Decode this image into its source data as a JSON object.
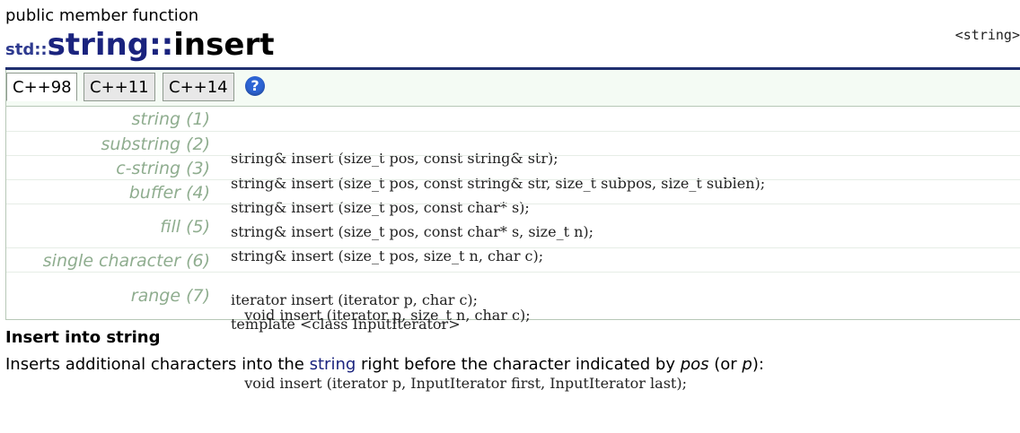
{
  "header": {
    "kind": "public member function",
    "namespace": "std::",
    "class_name": "string",
    "separator": "::",
    "function_name": "insert",
    "header_ref": "<string>"
  },
  "tabs": {
    "items": [
      {
        "label": "C++98",
        "active": true
      },
      {
        "label": "C++11",
        "active": false
      },
      {
        "label": "C++14",
        "active": false
      }
    ],
    "help_label": "?"
  },
  "signatures": [
    {
      "label": "string (1)",
      "lines": [
        "string& insert (size_t pos, const string& str);"
      ]
    },
    {
      "label": "substring (2)",
      "lines": [
        "string& insert (size_t pos, const string& str, size_t subpos, size_t sublen);"
      ]
    },
    {
      "label": "c-string (3)",
      "lines": [
        "string& insert (size_t pos, const char* s);"
      ]
    },
    {
      "label": "buffer (4)",
      "lines": [
        "string& insert (size_t pos, const char* s, size_t n);"
      ]
    },
    {
      "label": "fill (5)",
      "lines": [
        "string& insert (size_t pos, size_t n, char c);",
        "   void insert (iterator p, size_t n, char c);"
      ]
    },
    {
      "label": "single character (6)",
      "lines": [
        "iterator insert (iterator p, char c);"
      ]
    },
    {
      "label": "range (7)",
      "lines": [
        "template <class InputIterator>",
        "   void insert (iterator p, InputIterator first, InputIterator last);"
      ]
    }
  ],
  "section": {
    "title": "Insert into string",
    "desc_prefix": "Inserts additional characters into the ",
    "desc_link": "string",
    "desc_middle": " right before the character indicated by ",
    "desc_pos": "pos",
    "desc_or": " (or ",
    "desc_p": "p",
    "desc_end": "):"
  },
  "colors": {
    "accent": "#1a237e",
    "label_green": "#8fad8f",
    "help_blue": "#2d64d4"
  }
}
